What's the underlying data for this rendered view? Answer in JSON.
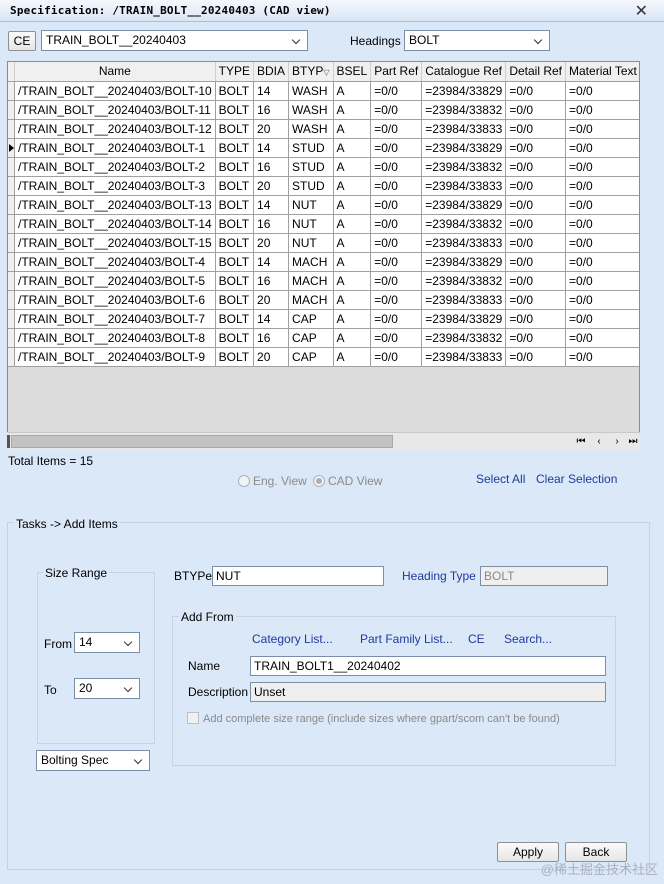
{
  "window": {
    "title": "Specification: /TRAIN_BOLT__20240403 (CAD view)",
    "close_glyph": "✕"
  },
  "toolbar": {
    "ce_label": "CE",
    "spec_value": "TRAIN_BOLT__20240403",
    "headings_label": "Headings",
    "headings_value": "BOLT"
  },
  "grid": {
    "columns": [
      "Name",
      "TYPE",
      "BDIA",
      "BTYP",
      "BSEL",
      "Part Ref",
      "Catalogue Ref",
      "Detail Ref",
      "Material Text Re"
    ],
    "sort_glyph": "▽",
    "rows": [
      [
        "/TRAIN_BOLT__20240403/BOLT-10",
        "BOLT",
        "14",
        "WASH",
        "A",
        "=0/0",
        "=23984/33829",
        "=0/0",
        "=0/0"
      ],
      [
        "/TRAIN_BOLT__20240403/BOLT-11",
        "BOLT",
        "16",
        "WASH",
        "A",
        "=0/0",
        "=23984/33832",
        "=0/0",
        "=0/0"
      ],
      [
        "/TRAIN_BOLT__20240403/BOLT-12",
        "BOLT",
        "20",
        "WASH",
        "A",
        "=0/0",
        "=23984/33833",
        "=0/0",
        "=0/0"
      ],
      [
        "/TRAIN_BOLT__20240403/BOLT-1",
        "BOLT",
        "14",
        "STUD",
        "A",
        "=0/0",
        "=23984/33829",
        "=0/0",
        "=0/0"
      ],
      [
        "/TRAIN_BOLT__20240403/BOLT-2",
        "BOLT",
        "16",
        "STUD",
        "A",
        "=0/0",
        "=23984/33832",
        "=0/0",
        "=0/0"
      ],
      [
        "/TRAIN_BOLT__20240403/BOLT-3",
        "BOLT",
        "20",
        "STUD",
        "A",
        "=0/0",
        "=23984/33833",
        "=0/0",
        "=0/0"
      ],
      [
        "/TRAIN_BOLT__20240403/BOLT-13",
        "BOLT",
        "14",
        "NUT",
        "A",
        "=0/0",
        "=23984/33829",
        "=0/0",
        "=0/0"
      ],
      [
        "/TRAIN_BOLT__20240403/BOLT-14",
        "BOLT",
        "16",
        "NUT",
        "A",
        "=0/0",
        "=23984/33832",
        "=0/0",
        "=0/0"
      ],
      [
        "/TRAIN_BOLT__20240403/BOLT-15",
        "BOLT",
        "20",
        "NUT",
        "A",
        "=0/0",
        "=23984/33833",
        "=0/0",
        "=0/0"
      ],
      [
        "/TRAIN_BOLT__20240403/BOLT-4",
        "BOLT",
        "14",
        "MACH",
        "A",
        "=0/0",
        "=23984/33829",
        "=0/0",
        "=0/0"
      ],
      [
        "/TRAIN_BOLT__20240403/BOLT-5",
        "BOLT",
        "16",
        "MACH",
        "A",
        "=0/0",
        "=23984/33832",
        "=0/0",
        "=0/0"
      ],
      [
        "/TRAIN_BOLT__20240403/BOLT-6",
        "BOLT",
        "20",
        "MACH",
        "A",
        "=0/0",
        "=23984/33833",
        "=0/0",
        "=0/0"
      ],
      [
        "/TRAIN_BOLT__20240403/BOLT-7",
        "BOLT",
        "14",
        "CAP",
        "A",
        "=0/0",
        "=23984/33829",
        "=0/0",
        "=0/0"
      ],
      [
        "/TRAIN_BOLT__20240403/BOLT-8",
        "BOLT",
        "16",
        "CAP",
        "A",
        "=0/0",
        "=23984/33832",
        "=0/0",
        "=0/0"
      ],
      [
        "/TRAIN_BOLT__20240403/BOLT-9",
        "BOLT",
        "20",
        "CAP",
        "A",
        "=0/0",
        "=23984/33833",
        "=0/0",
        "=0/0"
      ]
    ],
    "current_row_index": 3,
    "nav_first": "⏮",
    "nav_prev": "‹",
    "nav_next": "›",
    "nav_last": "⏭"
  },
  "status": {
    "total_items": "Total Items = 15"
  },
  "view_options": {
    "eng_view": "Eng. View",
    "cad_view": "CAD View",
    "selected": "CAD View",
    "select_all": "Select All",
    "clear_selection": "Clear Selection"
  },
  "tasks": {
    "title": "Tasks -> Add Items",
    "size_range": {
      "title": "Size Range",
      "from_label": "From",
      "from_value": "14",
      "to_label": "To",
      "to_value": "20"
    },
    "bolting_spec": "Bolting Spec",
    "btype_label": "BTYPe",
    "btype_value": "NUT",
    "heading_type_label": "Heading Type",
    "heading_type_value": "BOLT",
    "add_from": {
      "title": "Add From",
      "links": [
        "Category List...",
        "Part Family List...",
        "CE",
        "Search..."
      ],
      "name_label": "Name",
      "name_value": "TRAIN_BOLT1__20240402",
      "description_label": "Description",
      "description_value": "Unset",
      "complete_range_label": "Add complete size range (include sizes where gpart/scom can't be found)"
    }
  },
  "buttons": {
    "apply": "Apply",
    "back": "Back"
  },
  "watermark": "@稀土掘金技术社区"
}
